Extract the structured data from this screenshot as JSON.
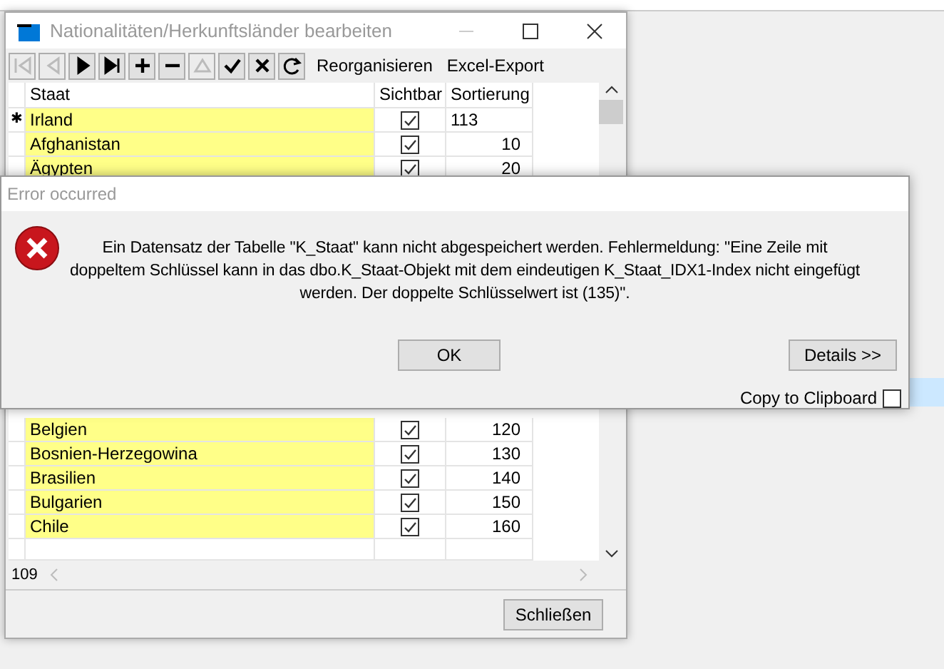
{
  "window": {
    "title": "Nationalitäten/Herkunftsländer bearbeiten"
  },
  "toolbar": [
    {
      "kind": "first",
      "disabled": true
    },
    {
      "kind": "prev",
      "disabled": true
    },
    {
      "kind": "next",
      "disabled": false
    },
    {
      "kind": "last",
      "disabled": false
    },
    {
      "kind": "add",
      "disabled": false
    },
    {
      "kind": "remove",
      "disabled": false
    },
    {
      "kind": "edit",
      "disabled": true
    },
    {
      "kind": "save",
      "disabled": false
    },
    {
      "kind": "cancel",
      "disabled": false
    },
    {
      "kind": "refresh",
      "disabled": false
    }
  ],
  "toolbar_links": [
    "Reorganisieren",
    "Excel-Export"
  ],
  "grid": {
    "columns": [
      "Staat",
      "Sichtbar",
      "Sortierung"
    ],
    "rows_top": [
      {
        "marker": "✱",
        "staat": "Irland",
        "visible": true,
        "sort": "113",
        "editing": true
      },
      {
        "staat": "Afghanistan",
        "visible": true,
        "sort": "10",
        "editing": false
      },
      {
        "staat": "Ägypten",
        "visible": true,
        "sort": "20",
        "editing": false
      }
    ],
    "rows_bottom": [
      {
        "staat": "Belgien",
        "visible": true,
        "sort": "120",
        "editing": false
      },
      {
        "staat": "Bosnien-Herzegowina",
        "visible": true,
        "sort": "130",
        "editing": false
      },
      {
        "staat": "Brasilien",
        "visible": true,
        "sort": "140",
        "editing": false
      },
      {
        "staat": "Bulgarien",
        "visible": true,
        "sort": "150",
        "editing": false
      },
      {
        "staat": "Chile",
        "visible": true,
        "sort": "160",
        "editing": false
      }
    ],
    "record_count": "109"
  },
  "close_button": "Schließen",
  "dialog": {
    "title": "Error occurred",
    "message": "Ein Datensatz der Tabelle \"K_Staat\" kann nicht abgespeichert werden. Fehlermeldung: \"Eine Zeile mit doppeltem Schlüssel kann in das dbo.K_Staat-Objekt mit dem eindeutigen K_Staat_IDX1-Index nicht eingefügt werden. Der doppelte Schlüsselwert ist (135)\".",
    "buttons": [
      "OK",
      "Details >>"
    ],
    "copy_label": "Copy to Clipboard",
    "copy_checked": false
  }
}
